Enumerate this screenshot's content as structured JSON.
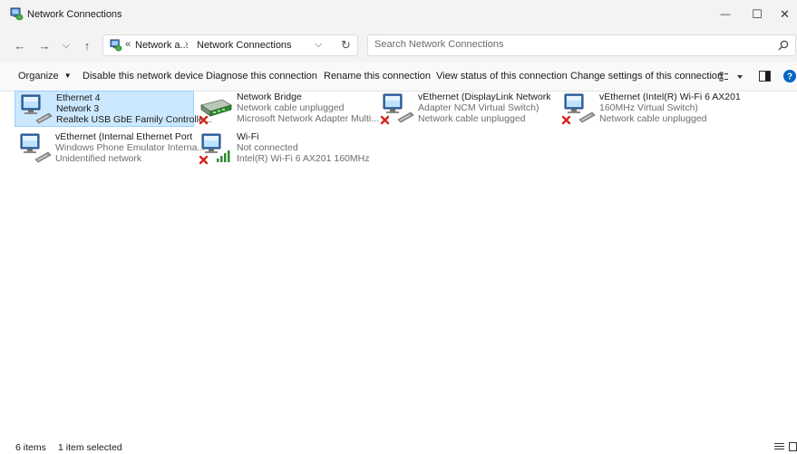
{
  "window": {
    "title": "Network Connections",
    "minimize_glyph": "—",
    "maximize_glyph": "☐",
    "close_glyph": "✕"
  },
  "navigation": {
    "back_glyph": "←",
    "forward_glyph": "→",
    "recent_glyph": "⌵",
    "up_glyph": "↑",
    "refresh_glyph": "↻",
    "breadcrumb": {
      "overflow": "«",
      "segments": [
        "Network a...",
        "Network Connections"
      ],
      "separator": "›",
      "dropdown_glyph": "⌵"
    },
    "search": {
      "placeholder": "Search Network Connections",
      "value": ""
    }
  },
  "commands": {
    "organize": "Organize",
    "disable": "Disable this network device",
    "diagnose": "Diagnose this connection",
    "rename": "Rename this connection",
    "view_status": "View status of this connection",
    "change_settings": "Change settings of this connection"
  },
  "items": [
    {
      "line1": "Ethernet 4",
      "line2": "Network 3",
      "line3": "Realtek USB GbE Family Controlle...",
      "type": "ethernet",
      "status": "connected",
      "selected": true
    },
    {
      "line1": "Network Bridge",
      "line2": "Network cable unplugged",
      "line3": "Microsoft Network Adapter Multi...",
      "type": "bridge",
      "status": "disconnected",
      "selected": false
    },
    {
      "line1": "vEthernet (DisplayLink Network",
      "line2": "Adapter NCM Virtual Switch)",
      "line3": "Network cable unplugged",
      "type": "ethernet",
      "status": "disconnected",
      "selected": false
    },
    {
      "line1": "vEthernet (Intel(R) Wi-Fi 6 AX201",
      "line2": "160MHz Virtual Switch)",
      "line3": "Network cable unplugged",
      "type": "ethernet",
      "status": "disconnected",
      "selected": false
    },
    {
      "line1": "vEthernet (Internal Ethernet Port",
      "line2": "Windows Phone Emulator Interna...",
      "line3": "Unidentified network",
      "type": "ethernet",
      "status": "connected",
      "selected": false
    },
    {
      "line1": "Wi-Fi",
      "line2": "Not connected",
      "line3": "Intel(R) Wi-Fi 6 AX201 160MHz",
      "type": "wifi",
      "status": "disconnected",
      "selected": false
    }
  ],
  "status_bar": {
    "count": "6 items",
    "selection": "1 item selected"
  },
  "colors": {
    "selection_bg": "#cce8ff",
    "selection_border": "#99d1ff",
    "error_red": "#d2261b",
    "help_blue": "#0067c0",
    "wifi_green": "#2e8b2e"
  }
}
